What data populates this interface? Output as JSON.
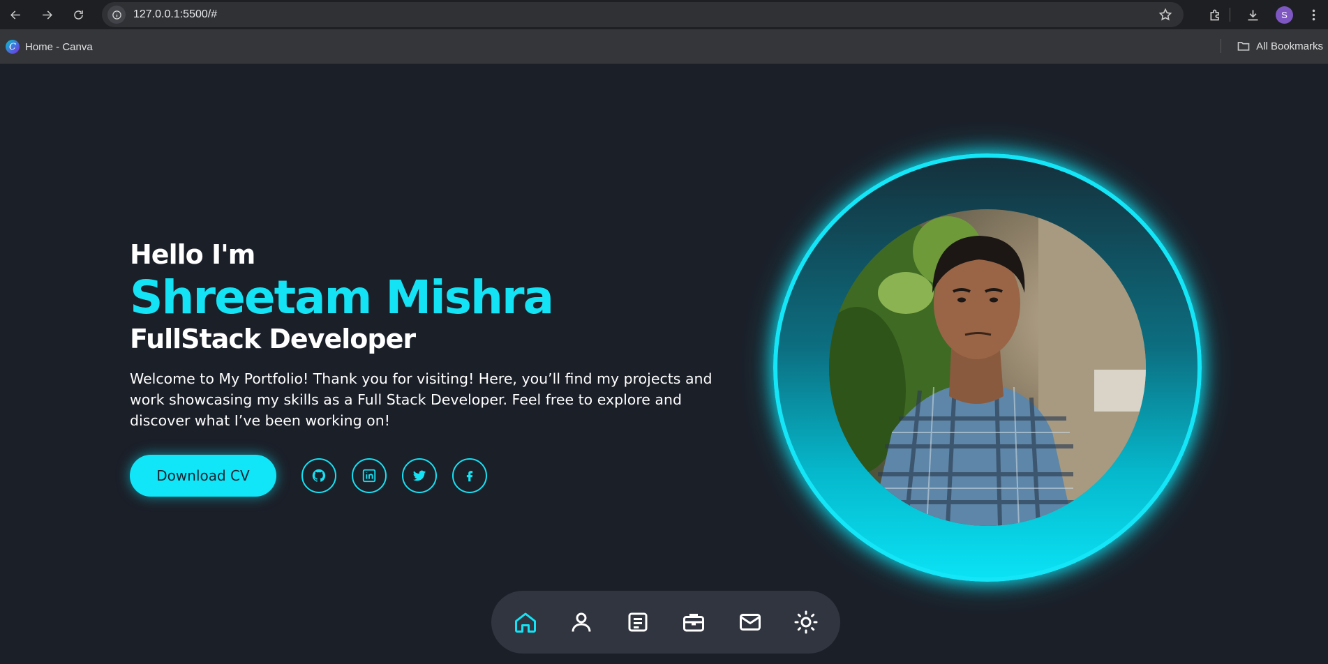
{
  "browser": {
    "url": "127.0.0.1:5500/#",
    "bookmark_label": "Home - Canva",
    "all_bookmarks_label": "All Bookmarks",
    "profile_initial": "S"
  },
  "hero": {
    "greeting": "Hello I'm",
    "name": "Shreetam Mishra",
    "role": "FullStack Developer",
    "intro": "Welcome to My Portfolio! Thank you for visiting! Here, you’ll find my projects and work showcasing my skills as a Full Stack Developer. Feel free to explore and discover what I’ve been working on!",
    "cv_button": "Download CV",
    "socials": [
      "github-icon",
      "linkedin-icon",
      "twitter-icon",
      "facebook-icon"
    ]
  },
  "dock": {
    "items": [
      "home-icon",
      "user-icon",
      "document-icon",
      "briefcase-icon",
      "mail-icon",
      "sun-icon"
    ],
    "active": "home-icon"
  },
  "colors": {
    "accent": "#14e3f5",
    "background": "#1b1f28",
    "dock": "#30353f"
  }
}
